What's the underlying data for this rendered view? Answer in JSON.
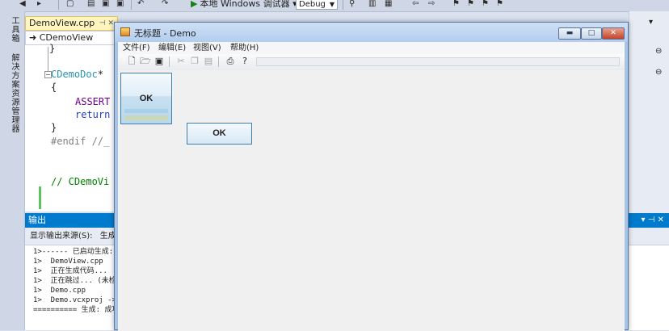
{
  "vs": {
    "run_label": "本地 Windows 调试器",
    "configuration": "Debug",
    "side_tabs": [
      "工具箱",
      "解决方案资源管理器"
    ],
    "document_tab": "DemoView.cpp",
    "nav_class": "CDemoView",
    "code_lines": {
      "l1": "}",
      "l2_type": "CDemoDoc",
      "l2_rest": "*",
      "l3": "{",
      "l4": "ASSERT",
      "l5": "return",
      "l6": "}",
      "l7": "#endif //_",
      "l8": "// CDemoVi"
    },
    "output": {
      "title": "输出",
      "source_label": "显示输出来源(S):",
      "source_value": "生成",
      "lines": [
        "1>------ 已启动生成:",
        "1>  DemoView.cpp",
        "1>  正在生成代码...",
        "1>  正在跳过... (未检",
        "1>  Demo.cpp",
        "1>  Demo.vcxproj ->",
        "========== 生成: 成功"
      ]
    }
  },
  "demo": {
    "title": "无标题 - Demo",
    "menus": [
      "文件(F)",
      "编辑(E)",
      "视图(V)",
      "帮助(H)"
    ],
    "ok_label_1": "OK",
    "ok_label_2": "OK"
  }
}
